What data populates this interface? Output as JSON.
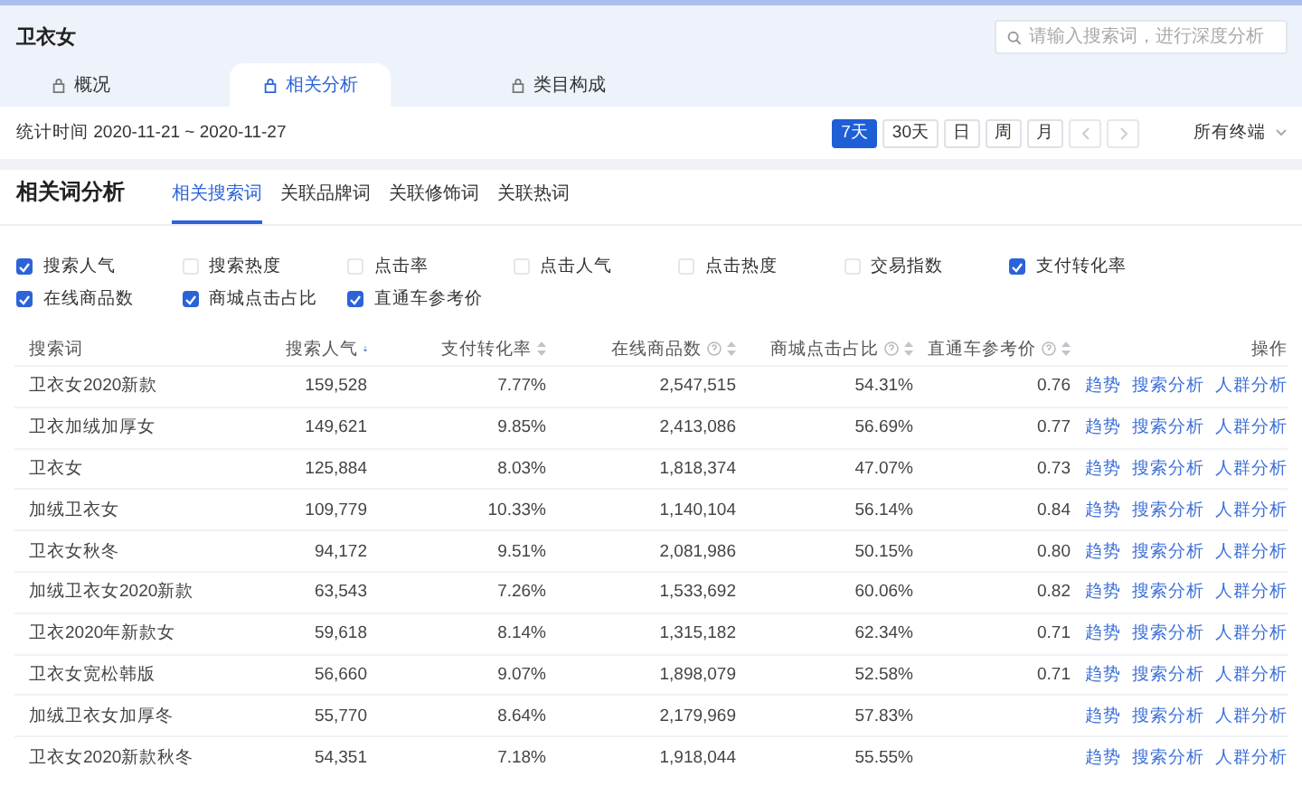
{
  "header": {
    "title": "卫衣女",
    "search": {
      "placeholder": "请输入搜索词，进行深度分析"
    }
  },
  "tabs": [
    {
      "label": "概况",
      "selected": false
    },
    {
      "label": "相关分析",
      "selected": true
    },
    {
      "label": "类目构成",
      "selected": false
    }
  ],
  "toolbar": {
    "date_range": "统计时间 2020-11-21 ~ 2020-11-27",
    "periods": [
      {
        "label": "7天",
        "selected": true
      },
      {
        "label": "30天",
        "selected": false
      },
      {
        "label": "日",
        "selected": false
      },
      {
        "label": "周",
        "selected": false
      },
      {
        "label": "月",
        "selected": false
      }
    ],
    "device": "所有终端"
  },
  "section": {
    "title": "相关词分析",
    "subtabs": [
      {
        "label": "相关搜索词",
        "selected": true
      },
      {
        "label": "关联品牌词",
        "selected": false
      },
      {
        "label": "关联修饰词",
        "selected": false
      },
      {
        "label": "关联热词",
        "selected": false
      }
    ]
  },
  "metrics": [
    {
      "label": "搜索人气",
      "checked": true
    },
    {
      "label": "搜索热度",
      "checked": false
    },
    {
      "label": "点击率",
      "checked": false
    },
    {
      "label": "点击人气",
      "checked": false
    },
    {
      "label": "点击热度",
      "checked": false
    },
    {
      "label": "交易指数",
      "checked": false
    },
    {
      "label": "支付转化率",
      "checked": true
    },
    {
      "label": "在线商品数",
      "checked": true
    },
    {
      "label": "商城点击占比",
      "checked": true
    },
    {
      "label": "直通车参考价",
      "checked": true
    }
  ],
  "table": {
    "columns": [
      {
        "label": "搜索词",
        "kind": "plain"
      },
      {
        "label": "搜索人气",
        "kind": "sorted"
      },
      {
        "label": "支付转化率",
        "kind": "sortable"
      },
      {
        "label": "在线商品数",
        "kind": "help"
      },
      {
        "label": "商城点击占比",
        "kind": "help"
      },
      {
        "label": "直通车参考价",
        "kind": "help"
      },
      {
        "label": "操作",
        "kind": "plain"
      }
    ],
    "rows": [
      {
        "term": "卫衣女2020新款",
        "popularity": "159,528",
        "conversion": "7.77%",
        "items": "2,547,515",
        "mall_share": "54.31%",
        "price": "0.76",
        "actions": [
          "趋势",
          "搜索分析",
          "人群分析"
        ]
      },
      {
        "term": "卫衣加绒加厚女",
        "popularity": "149,621",
        "conversion": "9.85%",
        "items": "2,413,086",
        "mall_share": "56.69%",
        "price": "0.77",
        "actions": [
          "趋势",
          "搜索分析",
          "人群分析"
        ]
      },
      {
        "term": "卫衣女",
        "popularity": "125,884",
        "conversion": "8.03%",
        "items": "1,818,374",
        "mall_share": "47.07%",
        "price": "0.73",
        "actions": [
          "趋势",
          "搜索分析",
          "人群分析"
        ]
      },
      {
        "term": "加绒卫衣女",
        "popularity": "109,779",
        "conversion": "10.33%",
        "items": "1,140,104",
        "mall_share": "56.14%",
        "price": "0.84",
        "actions": [
          "趋势",
          "搜索分析",
          "人群分析"
        ]
      },
      {
        "term": "卫衣女秋冬",
        "popularity": "94,172",
        "conversion": "9.51%",
        "items": "2,081,986",
        "mall_share": "50.15%",
        "price": "0.80",
        "actions": [
          "趋势",
          "搜索分析",
          "人群分析"
        ]
      },
      {
        "term": "加绒卫衣女2020新款",
        "popularity": "63,543",
        "conversion": "7.26%",
        "items": "1,533,692",
        "mall_share": "60.06%",
        "price": "0.82",
        "actions": [
          "趋势",
          "搜索分析",
          "人群分析"
        ]
      },
      {
        "term": "卫衣2020年新款女",
        "popularity": "59,618",
        "conversion": "8.14%",
        "items": "1,315,182",
        "mall_share": "62.34%",
        "price": "0.71",
        "actions": [
          "趋势",
          "搜索分析",
          "人群分析"
        ]
      },
      {
        "term": "卫衣女宽松韩版",
        "popularity": "56,660",
        "conversion": "9.07%",
        "items": "1,898,079",
        "mall_share": "52.58%",
        "price": "0.71",
        "actions": [
          "趋势",
          "搜索分析",
          "人群分析"
        ]
      },
      {
        "term": "加绒卫衣女加厚冬",
        "popularity": "55,770",
        "conversion": "8.64%",
        "items": "2,179,969",
        "mall_share": "57.83%",
        "actions": [
          "趋势",
          "搜索分析",
          "人群分析"
        ]
      },
      {
        "term": "卫衣女2020新款秋冬",
        "popularity": "54,351",
        "conversion": "7.18%",
        "items": "1,918,044",
        "mall_share": "55.55%",
        "actions": [
          "趋势",
          "搜索分析",
          "人群分析"
        ]
      }
    ]
  }
}
